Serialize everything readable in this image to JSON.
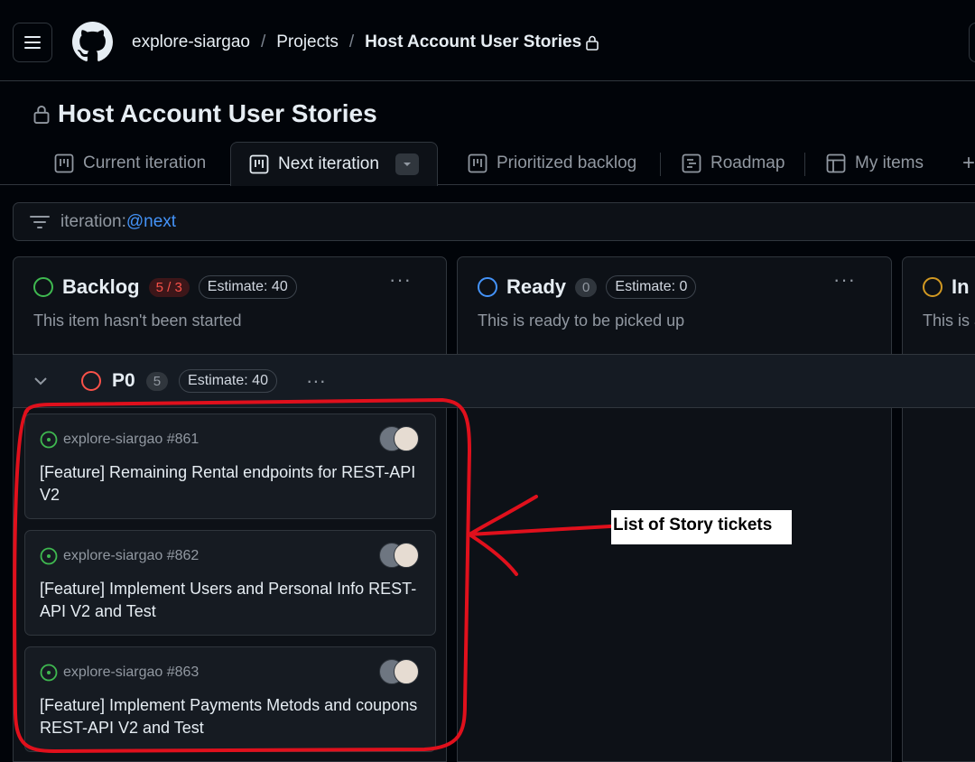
{
  "breadcrumb": {
    "org": "explore-siargao",
    "sep1": "/",
    "section": "Projects",
    "sep2": "/",
    "current": "Host Account User Stories"
  },
  "project": {
    "title": "Host Account User Stories"
  },
  "tabs": [
    {
      "label": "Current iteration"
    },
    {
      "label": "Next iteration"
    },
    {
      "label": "Prioritized backlog"
    },
    {
      "label": "Roadmap"
    },
    {
      "label": "My items"
    }
  ],
  "add_tab": "+",
  "filter": {
    "key": "iteration:",
    "value": "@next"
  },
  "columns": [
    {
      "name": "Backlog",
      "count": "5 / 3",
      "estimate": "Estimate: 40",
      "description": "This item hasn't been started",
      "color": "#3fb950"
    },
    {
      "name": "Ready",
      "count": "0",
      "estimate": "Estimate: 0",
      "description": "This is ready to be picked up",
      "color": "#4493f8"
    },
    {
      "name": "In",
      "description": "This is a",
      "color": "#d29922"
    }
  ],
  "group": {
    "name": "P0",
    "count": "5",
    "estimate": "Estimate: 40",
    "color": "#f85149"
  },
  "cards": [
    {
      "repo": "explore-siargao #861",
      "title": "[Feature] Remaining Rental endpoints for REST-API V2"
    },
    {
      "repo": "explore-siargao #862",
      "title": "[Feature] Implement Users and Personal Info REST-API V2 and Test"
    },
    {
      "repo": "explore-siargao #863",
      "title": "[Feature] Implement Payments Metods and coupons REST-API V2 and Test"
    }
  ],
  "annotation": {
    "label": "List of Story tickets",
    "color": "#e0101c"
  },
  "more": "···"
}
